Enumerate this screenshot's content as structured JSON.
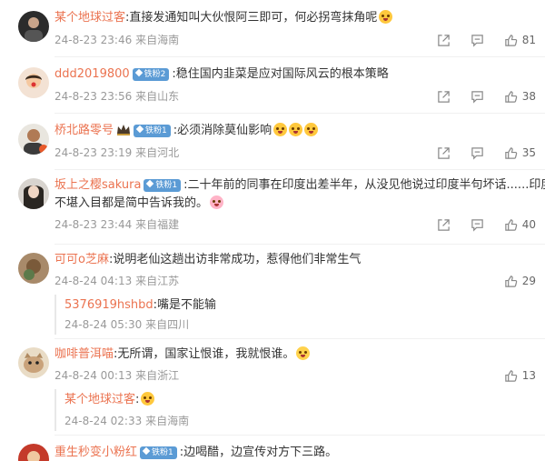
{
  "comments": [
    {
      "user": "某个地球过客",
      "text": ":直接发通知叫大伙恨阿三即可，何必拐弯抹角呢",
      "time": "24-8-23 23:46",
      "location": "来自海南",
      "likes": "81"
    },
    {
      "user": "ddd2019800",
      "badge": "铁粉2",
      "text": ":稳住国内韭菜是应对国际风云的根本策略",
      "time": "24-8-23 23:56",
      "location": "来自山东",
      "likes": "38"
    },
    {
      "user": "桥北路零号",
      "badge": "铁粉1",
      "text": ":必须消除莫仙影响",
      "time": "24-8-23 23:19",
      "location": "来自河北",
      "likes": "35"
    },
    {
      "user": "坂上之樱sakura",
      "badge": "铁粉1",
      "text": ":二十年前的同事在印度出差半年，从没见他说过印度半句坏话......印度的",
      "text2": "不堪入目都是简中告诉我的。",
      "time": "24-8-23 23:44",
      "location": "来自福建",
      "likes": "40"
    },
    {
      "user": "可可o芝麻",
      "text": ":说明老仙这趟出访非常成功，惹得他们非常生气",
      "time": "24-8-24 04:13",
      "location": "来自江苏",
      "likes": "29",
      "reply": {
        "user": "5376919hshbd",
        "text": ":嘴是不能输",
        "time": "24-8-24 05:30",
        "location": "来自四川"
      }
    },
    {
      "user": "咖啡普洱喵",
      "text": ":无所谓，国家让恨谁，我就恨谁。",
      "time": "24-8-24 00:13",
      "location": "来自浙江",
      "likes": "13",
      "reply": {
        "user": "某个地球过客",
        "text": ":",
        "time": "24-8-24 02:33",
        "location": "来自海南"
      }
    },
    {
      "user": "重生秒变小粉红",
      "badge": "铁粉1",
      "text": ":边喝醋，边宣传对方下三路。"
    }
  ]
}
